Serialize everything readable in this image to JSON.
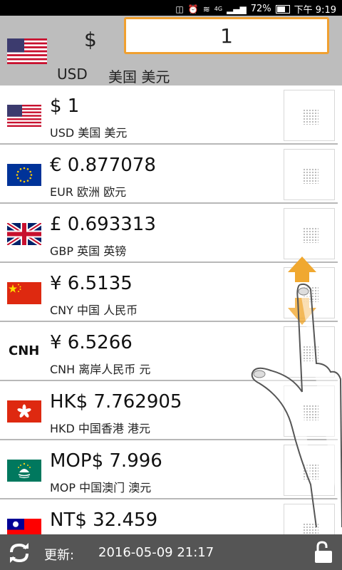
{
  "status_bar": {
    "battery": "72%",
    "time": "下午 9:19",
    "network": "4G"
  },
  "header": {
    "symbol": "$",
    "amount": "1",
    "code": "USD",
    "name": "美国 美元"
  },
  "currencies": [
    {
      "value": "$ 1",
      "code_name": "USD 美国 美元",
      "flag": "us-flag-icon"
    },
    {
      "value": "€ 0.877078",
      "code_name": "EUR 欧洲 欧元",
      "flag": "eu-flag-icon"
    },
    {
      "value": "£ 0.693313",
      "code_name": "GBP 英国 英镑",
      "flag": "uk-flag-icon"
    },
    {
      "value": "¥ 6.5135",
      "code_name": "CNY 中国 人民币",
      "flag": "cn-flag-icon"
    },
    {
      "value": "¥ 6.5266",
      "code_name": "CNH 离岸人民币 元",
      "flag": "cnh-logo",
      "flag_text": "CNH"
    },
    {
      "value": "HK$ 7.762905",
      "code_name": "HKD 中国香港 港元",
      "flag": "hk-flag-icon"
    },
    {
      "value": "MOP$ 7.996",
      "code_name": "MOP 中国澳门 澳元",
      "flag": "mo-flag-icon"
    },
    {
      "value": "NT$ 32.459",
      "code_name": "",
      "flag": "tw-flag-icon"
    }
  ],
  "bottom_bar": {
    "update_label": "更新:",
    "update_time": "2016-05-09 21:17"
  },
  "colors": {
    "accent": "#f0a030",
    "header_bg": "#bdbdbd",
    "bottom_bg": "#555555"
  }
}
